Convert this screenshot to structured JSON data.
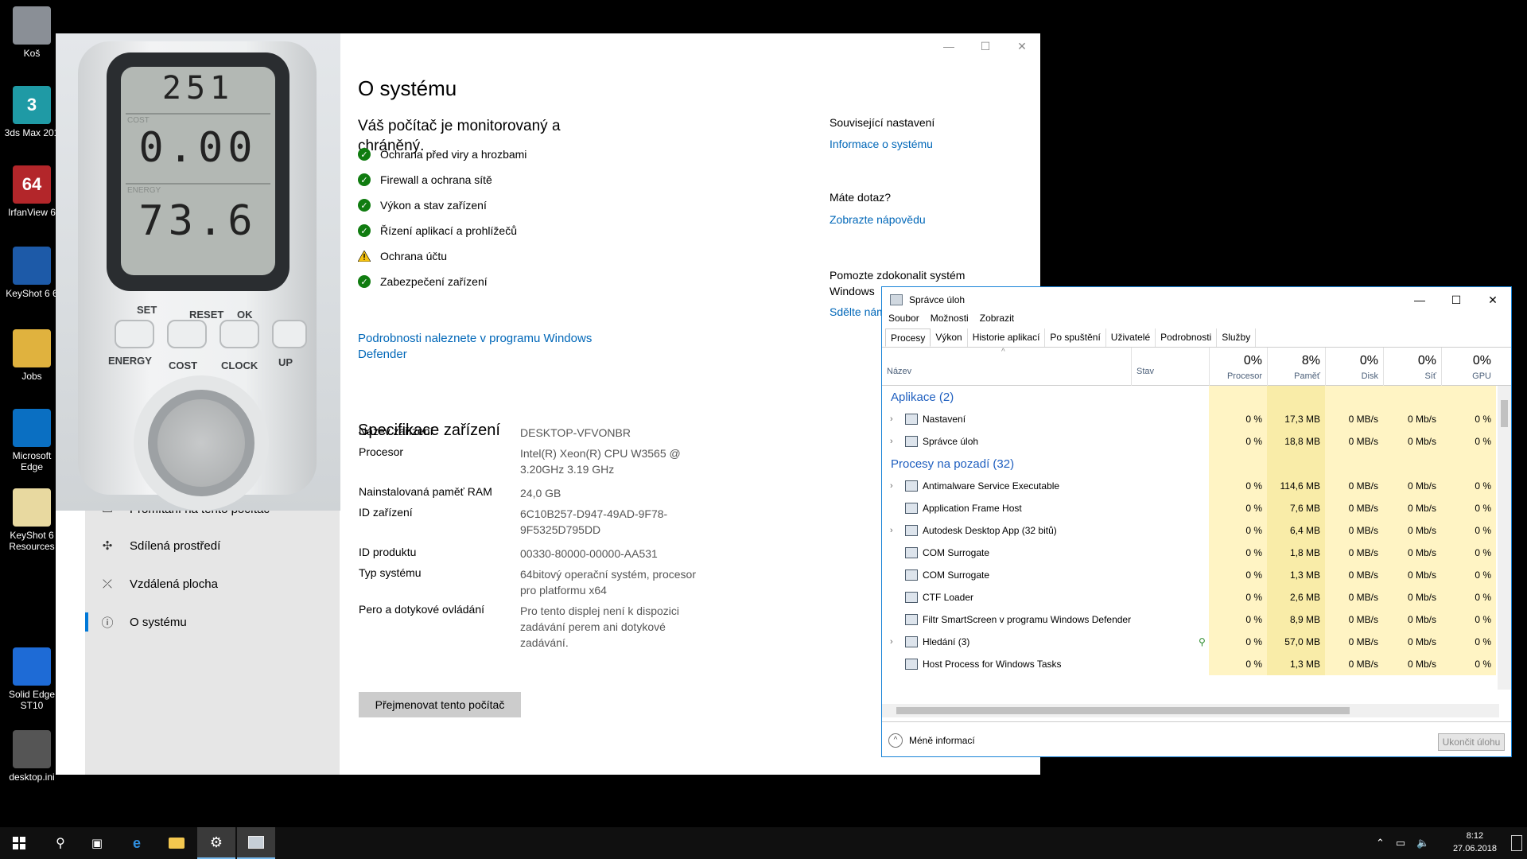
{
  "desktop": {
    "icons": [
      {
        "label": "Koš",
        "icon": "recycle-bin-icon"
      },
      {
        "label": "3ds Max 201",
        "icon": "3ds-max-icon",
        "badge": "3"
      },
      {
        "label": "IrfanView 6",
        "icon": "irfanview-icon",
        "badge": "64"
      },
      {
        "label": "KeyShot 6 6",
        "icon": "keyshot-icon"
      },
      {
        "label": "Jobs",
        "icon": "folder-icon"
      },
      {
        "label": "Microsoft Edge",
        "icon": "edge-icon"
      },
      {
        "label": "KeyShot 6 Resources",
        "icon": "folder-icon"
      },
      {
        "label": "Solid Edge ST10",
        "icon": "solid-edge-icon"
      },
      {
        "label": "desktop.ini",
        "icon": "ini-file-icon"
      }
    ]
  },
  "settings": {
    "window_controls": {
      "minimize": "—",
      "maximize": "☐",
      "close": "✕"
    },
    "nav": [
      {
        "label": "Promítání na tento počítač",
        "icon": "project-icon"
      },
      {
        "label": "Sdílená prostředí",
        "icon": "shared-experiences-icon"
      },
      {
        "label": "Vzdálená plocha",
        "icon": "remote-desktop-icon"
      },
      {
        "label": "O systému",
        "icon": "info-icon"
      }
    ],
    "meter": {
      "row1": "251",
      "row2": "0.00",
      "row3": "73.6",
      "row1_label": "COST",
      "row3_label": "ENERGY",
      "buttons": [
        "ENERGY",
        "COST",
        "CLOCK",
        "UP"
      ],
      "top_labels": [
        "SET",
        "RESET",
        "OK"
      ]
    },
    "title": "O systému",
    "protection_heading": "Váš počítač je monitorovaný a chráněný.",
    "status_items": [
      {
        "label": "Ochrana před viry a hrozbami",
        "state": "ok"
      },
      {
        "label": "Firewall a ochrana sítě",
        "state": "ok"
      },
      {
        "label": "Výkon a stav zařízení",
        "state": "ok"
      },
      {
        "label": "Řízení aplikací a prohlížečů",
        "state": "ok"
      },
      {
        "label": "Ochrana účtu",
        "state": "warning"
      },
      {
        "label": "Zabezpečení zařízení",
        "state": "ok"
      }
    ],
    "defender_link": "Podrobnosti naleznete v programu Windows Defender",
    "spec_heading": "Specifikace zařízení",
    "specs": [
      {
        "label": "Název zařízení",
        "value": "DESKTOP-VFVONBR"
      },
      {
        "label": "Procesor",
        "value": "Intel(R) Xeon(R) CPU W3565 @ 3.20GHz 3.19 GHz"
      },
      {
        "label": "Nainstalovaná paměť RAM",
        "value": "24,0 GB"
      },
      {
        "label": "ID zařízení",
        "value": "6C10B257-D947-49AD-9F78-9F5325D795DD"
      },
      {
        "label": "ID produktu",
        "value": "00330-80000-00000-AA531"
      },
      {
        "label": "Typ systému",
        "value": "64bitový operační systém, procesor pro platformu x64"
      },
      {
        "label": "Pero a dotykové ovládání",
        "value": "Pro tento displej není k dispozici zadávání perem ani dotykové zadávání."
      }
    ],
    "rename_button": "Přejmenovat tento počítač",
    "related": {
      "heading": "Související nastavení",
      "link": "Informace o systému",
      "question_heading": "Máte dotaz?",
      "help_link": "Zobrazte nápovědu",
      "improve_heading": "Pomozte zdokonalit systém Windows",
      "feedback_link": "Sdělte nám"
    }
  },
  "taskmgr": {
    "title": "Správce úloh",
    "menu": [
      "Soubor",
      "Možnosti",
      "Zobrazit"
    ],
    "tabs": [
      "Procesy",
      "Výkon",
      "Historie aplikací",
      "Po spuštění",
      "Uživatelé",
      "Podrobnosti",
      "Služby"
    ],
    "active_tab": "Procesy",
    "columns": [
      {
        "name": "Název",
        "pct": ""
      },
      {
        "name": "Stav",
        "pct": ""
      },
      {
        "name": "Procesor",
        "pct": "0%"
      },
      {
        "name": "Paměť",
        "pct": "8%"
      },
      {
        "name": "Disk",
        "pct": "0%"
      },
      {
        "name": "Síť",
        "pct": "0%"
      },
      {
        "name": "GPU",
        "pct": "0%"
      }
    ],
    "groups": [
      {
        "name": "Aplikace (2)",
        "rows": [
          {
            "name": "Nastavení",
            "expand": true,
            "icon": "settings-gear-icon",
            "cpu": "0 %",
            "mem": "17,3 MB",
            "disk": "0 MB/s",
            "net": "0 Mb/s",
            "gpu": "0 %"
          },
          {
            "name": "Správce úloh",
            "expand": true,
            "icon": "task-manager-icon",
            "cpu": "0 %",
            "mem": "18,8 MB",
            "disk": "0 MB/s",
            "net": "0 Mb/s",
            "gpu": "0 %"
          }
        ]
      },
      {
        "name": "Procesy na pozadí (32)",
        "rows": [
          {
            "name": "Antimalware Service Executable",
            "expand": true,
            "icon": "process-window-icon",
            "cpu": "0 %",
            "mem": "114,6 MB",
            "disk": "0 MB/s",
            "net": "0 Mb/s",
            "gpu": "0 %"
          },
          {
            "name": "Application Frame Host",
            "expand": false,
            "icon": "process-window-icon",
            "cpu": "0 %",
            "mem": "7,6 MB",
            "disk": "0 MB/s",
            "net": "0 Mb/s",
            "gpu": "0 %"
          },
          {
            "name": "Autodesk Desktop App (32 bitů)",
            "expand": true,
            "icon": "autodesk-icon",
            "cpu": "0 %",
            "mem": "6,4 MB",
            "disk": "0 MB/s",
            "net": "0 Mb/s",
            "gpu": "0 %"
          },
          {
            "name": "COM Surrogate",
            "expand": false,
            "icon": "process-window-icon",
            "cpu": "0 %",
            "mem": "1,8 MB",
            "disk": "0 MB/s",
            "net": "0 Mb/s",
            "gpu": "0 %"
          },
          {
            "name": "COM Surrogate",
            "expand": false,
            "icon": "process-window-icon",
            "cpu": "0 %",
            "mem": "1,3 MB",
            "disk": "0 MB/s",
            "net": "0 Mb/s",
            "gpu": "0 %"
          },
          {
            "name": "CTF Loader",
            "expand": false,
            "icon": "ctf-loader-icon",
            "cpu": "0 %",
            "mem": "2,6 MB",
            "disk": "0 MB/s",
            "net": "0 Mb/s",
            "gpu": "0 %"
          },
          {
            "name": "Filtr SmartScreen v programu Windows Defender",
            "expand": false,
            "icon": "process-window-icon",
            "cpu": "0 %",
            "mem": "8,9 MB",
            "disk": "0 MB/s",
            "net": "0 Mb/s",
            "gpu": "0 %"
          },
          {
            "name": "Hledání (3)",
            "expand": true,
            "icon": "search-icon",
            "status_icon": "leaf-icon",
            "cpu": "0 %",
            "mem": "57,0 MB",
            "disk": "0 MB/s",
            "net": "0 Mb/s",
            "gpu": "0 %"
          },
          {
            "name": "Host Process for Windows Tasks",
            "expand": false,
            "icon": "process-window-icon",
            "cpu": "0 %",
            "mem": "1,3 MB",
            "disk": "0 MB/s",
            "net": "0 Mb/s",
            "gpu": "0 %"
          }
        ]
      }
    ],
    "less_details": "Méně informací",
    "end_task": "Ukončit úlohu"
  },
  "taskbar": {
    "time": "8:12",
    "date": "27.06.2018"
  }
}
